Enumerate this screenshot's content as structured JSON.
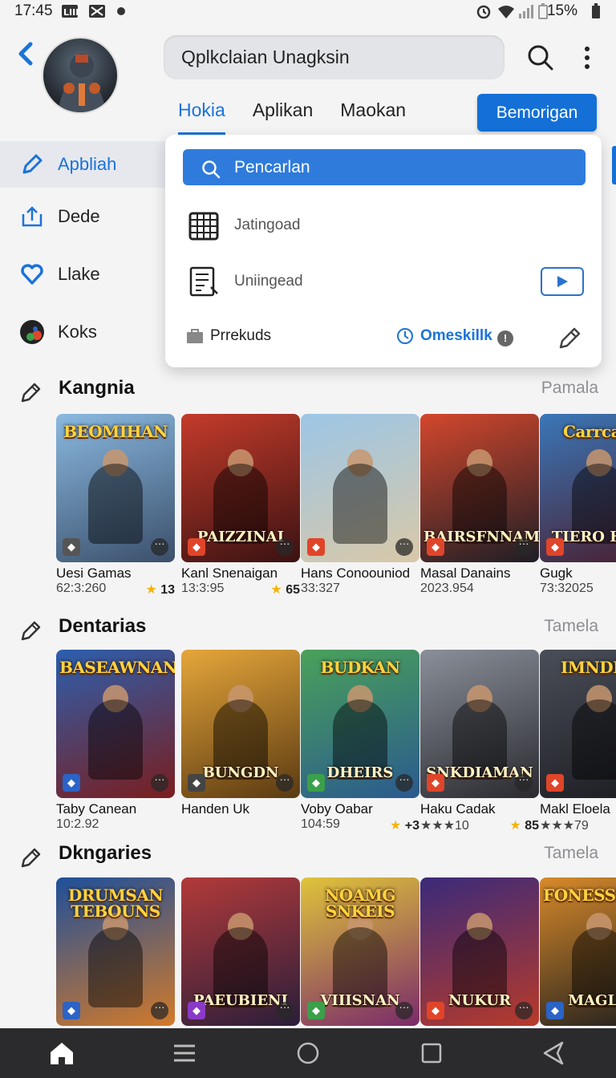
{
  "status": {
    "time": "17:45",
    "battery": "15%"
  },
  "header": {
    "search_text": "Qplkclaian Unagksin",
    "tabs": [
      {
        "label": "Hokia"
      },
      {
        "label": "Aplikan"
      },
      {
        "label": "Maokan"
      }
    ],
    "primary_button": "Bemorigan"
  },
  "sidebar": {
    "items": [
      {
        "label": "Apbliah"
      },
      {
        "label": "Dede"
      },
      {
        "label": "Llake"
      },
      {
        "label": "Koks"
      }
    ]
  },
  "dropdown": {
    "search_label": "Pencarlan",
    "rows": [
      {
        "label": "Jatingoad"
      },
      {
        "label": "Uniingead"
      }
    ],
    "footer_left": "Prrekuds",
    "footer_link": "Omeskillk"
  },
  "sections": [
    {
      "title": "Kangnia",
      "more": "Pamala",
      "cards": [
        {
          "name": "Uesi Gamas",
          "meta": "62:3:260",
          "rating": "13",
          "top": "BEOMIHAN",
          "bottom": "",
          "bg": [
            "#8ab9e0",
            "#3b4f6b"
          ],
          "badge": "#555"
        },
        {
          "name": "Kanl Snenaigan",
          "meta": "13:3:95",
          "rating": "65",
          "top": "",
          "bottom": "PAIZZINAI",
          "bg": [
            "#c43b2b",
            "#3a1212"
          ],
          "badge": "#e0452a"
        },
        {
          "name": "Hans Conoouniod",
          "meta": "33:327",
          "rating": "",
          "top": "",
          "bottom": "",
          "bg": [
            "#9cc6e6",
            "#d9c8a8"
          ],
          "badge": "#e0452a"
        },
        {
          "name": "Masal Danains",
          "meta": "2023.954",
          "rating": "",
          "top": "",
          "bottom": "BAIRSFNNAMN",
          "bg": [
            "#d3472c",
            "#1e1e26"
          ],
          "badge": "#e0452a"
        },
        {
          "name": "Gugk",
          "meta": "73:32025",
          "rating": "",
          "top": "Carrcaiz",
          "bottom": "TIERO HRA",
          "bg": [
            "#3a77b8",
            "#4a1e2e"
          ],
          "badge": "#e0452a"
        }
      ]
    },
    {
      "title": "Dentarias",
      "more": "Tamela",
      "cards": [
        {
          "name": "Taby Canean",
          "meta": "10:2.92",
          "rating": "",
          "top": "BASEAWNAN",
          "bottom": "",
          "bg": [
            "#2c5fae",
            "#7a1e1e"
          ],
          "badge": "#2b63c7"
        },
        {
          "name": "Handen Uk",
          "meta": "",
          "rating": "",
          "top": "",
          "bottom": "BUNGDN",
          "bg": [
            "#e6a63a",
            "#5a3a12"
          ],
          "badge": "#444"
        },
        {
          "name": "Voby Oabar",
          "meta": "104:59",
          "rating": "+3",
          "top": "BUDKAN",
          "bottom": "DHEIRS",
          "bg": [
            "#4aa15a",
            "#2a5a8e"
          ],
          "badge": "#3aa04a"
        },
        {
          "name": "Haku Cadak",
          "meta": "★★★10",
          "rating": "85",
          "top": "",
          "bottom": "SNKDIAMAN",
          "bg": [
            "#8a8f99",
            "#2a2a30"
          ],
          "badge": "#e0452a"
        },
        {
          "name": "Makl Eloela",
          "meta": "★★★79",
          "rating": "",
          "top": "IMNDER",
          "bottom": "",
          "bg": [
            "#4a4e58",
            "#1c1c22"
          ],
          "badge": "#e0452a"
        }
      ]
    },
    {
      "title": "Dkngaries",
      "more": "Tamela",
      "cards": [
        {
          "name": "",
          "meta": "",
          "rating": "",
          "top": "DRUMSAN TEBOUNS",
          "bottom": "",
          "bg": [
            "#1e4f9a",
            "#d27a2a"
          ],
          "badge": "#2b63c7"
        },
        {
          "name": "",
          "meta": "",
          "rating": "",
          "top": "",
          "bottom": "PAEUBIENI",
          "bg": [
            "#b23a3a",
            "#2a1e3a"
          ],
          "badge": "#8a3ac7"
        },
        {
          "name": "",
          "meta": "",
          "rating": "",
          "top": "NOAMG SNKEIS",
          "bottom": "VIIISNAN",
          "bg": [
            "#e0c43a",
            "#7a2a6a"
          ],
          "badge": "#3aa04a"
        },
        {
          "name": "",
          "meta": "",
          "rating": "",
          "top": "",
          "bottom": "NUKUR",
          "bg": [
            "#3a2a7a",
            "#b83a2a"
          ],
          "badge": "#e0452a"
        },
        {
          "name": "",
          "meta": "",
          "rating": "",
          "top": "FONESSINAN",
          "bottom": "MAGLO",
          "bg": [
            "#d88a2a",
            "#1e1e1e"
          ],
          "badge": "#2b63c7"
        }
      ]
    }
  ]
}
